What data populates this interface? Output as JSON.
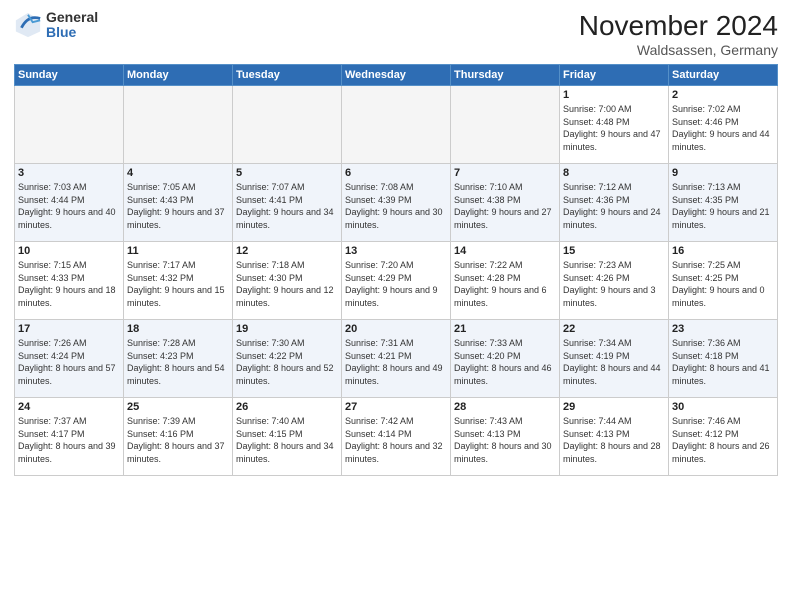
{
  "header": {
    "logo_general": "General",
    "logo_blue": "Blue",
    "month_title": "November 2024",
    "location": "Waldsassen, Germany"
  },
  "weekdays": [
    "Sunday",
    "Monday",
    "Tuesday",
    "Wednesday",
    "Thursday",
    "Friday",
    "Saturday"
  ],
  "weeks": [
    [
      {
        "day": "",
        "info": ""
      },
      {
        "day": "",
        "info": ""
      },
      {
        "day": "",
        "info": ""
      },
      {
        "day": "",
        "info": ""
      },
      {
        "day": "",
        "info": ""
      },
      {
        "day": "1",
        "info": "Sunrise: 7:00 AM\nSunset: 4:48 PM\nDaylight: 9 hours and 47 minutes."
      },
      {
        "day": "2",
        "info": "Sunrise: 7:02 AM\nSunset: 4:46 PM\nDaylight: 9 hours and 44 minutes."
      }
    ],
    [
      {
        "day": "3",
        "info": "Sunrise: 7:03 AM\nSunset: 4:44 PM\nDaylight: 9 hours and 40 minutes."
      },
      {
        "day": "4",
        "info": "Sunrise: 7:05 AM\nSunset: 4:43 PM\nDaylight: 9 hours and 37 minutes."
      },
      {
        "day": "5",
        "info": "Sunrise: 7:07 AM\nSunset: 4:41 PM\nDaylight: 9 hours and 34 minutes."
      },
      {
        "day": "6",
        "info": "Sunrise: 7:08 AM\nSunset: 4:39 PM\nDaylight: 9 hours and 30 minutes."
      },
      {
        "day": "7",
        "info": "Sunrise: 7:10 AM\nSunset: 4:38 PM\nDaylight: 9 hours and 27 minutes."
      },
      {
        "day": "8",
        "info": "Sunrise: 7:12 AM\nSunset: 4:36 PM\nDaylight: 9 hours and 24 minutes."
      },
      {
        "day": "9",
        "info": "Sunrise: 7:13 AM\nSunset: 4:35 PM\nDaylight: 9 hours and 21 minutes."
      }
    ],
    [
      {
        "day": "10",
        "info": "Sunrise: 7:15 AM\nSunset: 4:33 PM\nDaylight: 9 hours and 18 minutes."
      },
      {
        "day": "11",
        "info": "Sunrise: 7:17 AM\nSunset: 4:32 PM\nDaylight: 9 hours and 15 minutes."
      },
      {
        "day": "12",
        "info": "Sunrise: 7:18 AM\nSunset: 4:30 PM\nDaylight: 9 hours and 12 minutes."
      },
      {
        "day": "13",
        "info": "Sunrise: 7:20 AM\nSunset: 4:29 PM\nDaylight: 9 hours and 9 minutes."
      },
      {
        "day": "14",
        "info": "Sunrise: 7:22 AM\nSunset: 4:28 PM\nDaylight: 9 hours and 6 minutes."
      },
      {
        "day": "15",
        "info": "Sunrise: 7:23 AM\nSunset: 4:26 PM\nDaylight: 9 hours and 3 minutes."
      },
      {
        "day": "16",
        "info": "Sunrise: 7:25 AM\nSunset: 4:25 PM\nDaylight: 9 hours and 0 minutes."
      }
    ],
    [
      {
        "day": "17",
        "info": "Sunrise: 7:26 AM\nSunset: 4:24 PM\nDaylight: 8 hours and 57 minutes."
      },
      {
        "day": "18",
        "info": "Sunrise: 7:28 AM\nSunset: 4:23 PM\nDaylight: 8 hours and 54 minutes."
      },
      {
        "day": "19",
        "info": "Sunrise: 7:30 AM\nSunset: 4:22 PM\nDaylight: 8 hours and 52 minutes."
      },
      {
        "day": "20",
        "info": "Sunrise: 7:31 AM\nSunset: 4:21 PM\nDaylight: 8 hours and 49 minutes."
      },
      {
        "day": "21",
        "info": "Sunrise: 7:33 AM\nSunset: 4:20 PM\nDaylight: 8 hours and 46 minutes."
      },
      {
        "day": "22",
        "info": "Sunrise: 7:34 AM\nSunset: 4:19 PM\nDaylight: 8 hours and 44 minutes."
      },
      {
        "day": "23",
        "info": "Sunrise: 7:36 AM\nSunset: 4:18 PM\nDaylight: 8 hours and 41 minutes."
      }
    ],
    [
      {
        "day": "24",
        "info": "Sunrise: 7:37 AM\nSunset: 4:17 PM\nDaylight: 8 hours and 39 minutes."
      },
      {
        "day": "25",
        "info": "Sunrise: 7:39 AM\nSunset: 4:16 PM\nDaylight: 8 hours and 37 minutes."
      },
      {
        "day": "26",
        "info": "Sunrise: 7:40 AM\nSunset: 4:15 PM\nDaylight: 8 hours and 34 minutes."
      },
      {
        "day": "27",
        "info": "Sunrise: 7:42 AM\nSunset: 4:14 PM\nDaylight: 8 hours and 32 minutes."
      },
      {
        "day": "28",
        "info": "Sunrise: 7:43 AM\nSunset: 4:13 PM\nDaylight: 8 hours and 30 minutes."
      },
      {
        "day": "29",
        "info": "Sunrise: 7:44 AM\nSunset: 4:13 PM\nDaylight: 8 hours and 28 minutes."
      },
      {
        "day": "30",
        "info": "Sunrise: 7:46 AM\nSunset: 4:12 PM\nDaylight: 8 hours and 26 minutes."
      }
    ]
  ]
}
